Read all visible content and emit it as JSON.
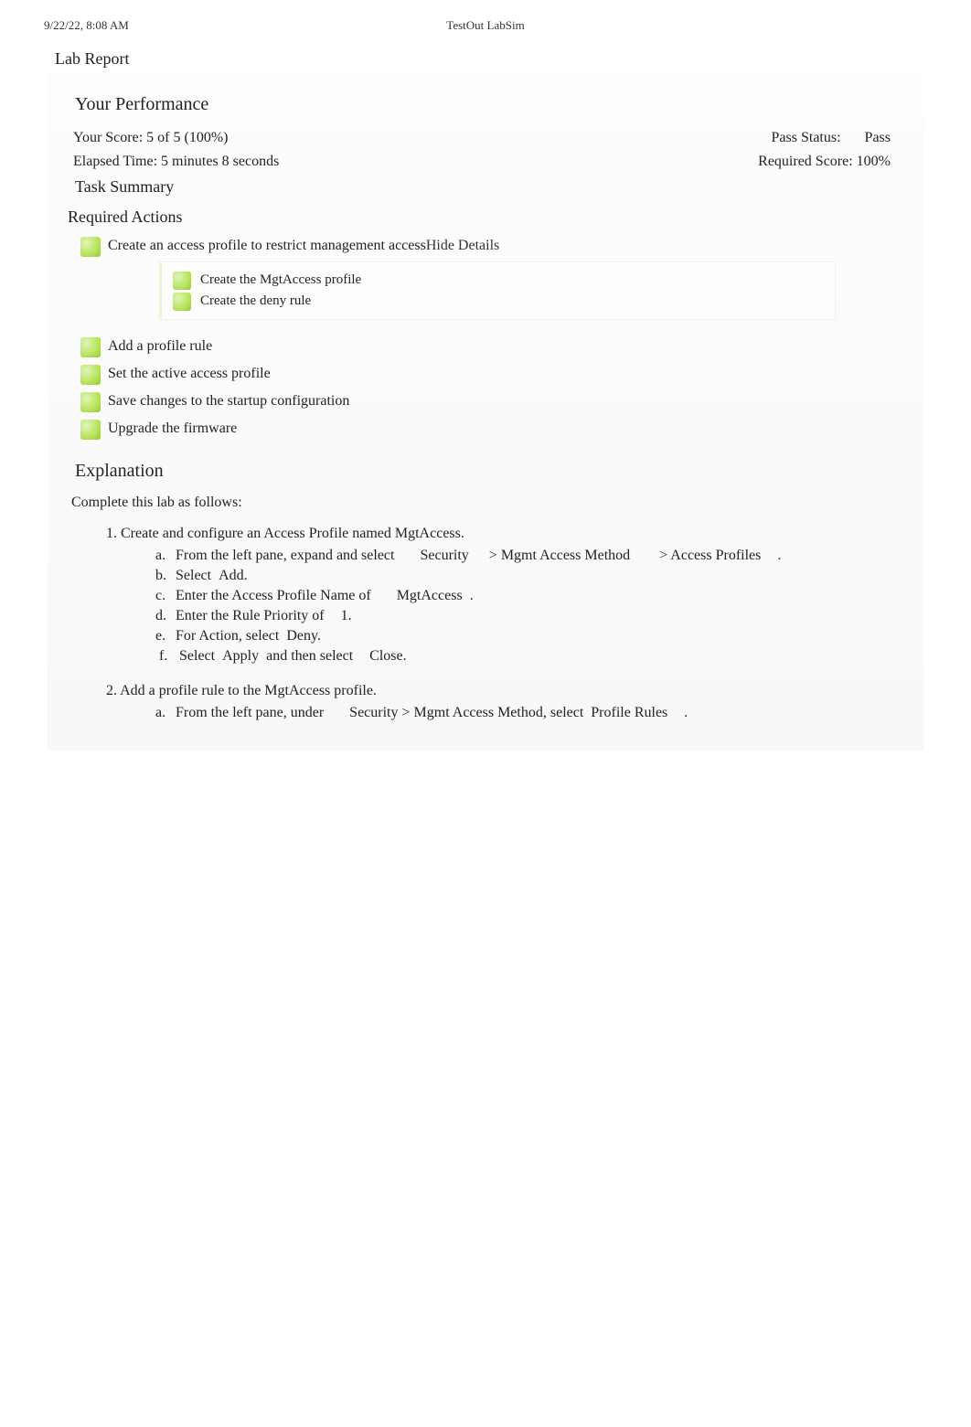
{
  "header": {
    "datetime": "9/22/22, 8:08 AM",
    "center": "TestOut LabSim"
  },
  "lab_title": "Lab Report",
  "performance": {
    "heading": "Your Performance",
    "score_label": "Your Score: 5 of 5 (100%)",
    "pass_status_label": "Pass Status:",
    "pass_status_value": "Pass",
    "elapsed_label": "Elapsed Time: 5 minutes 8 seconds",
    "required_label": "Required Score: 100%"
  },
  "task_summary": {
    "heading": "Task Summary",
    "required_label": "Required Actions",
    "items": [
      {
        "text": "Create an access profile to restrict management access",
        "hide": "Hide Details",
        "sub": [
          "Create the MgtAccess profile",
          "Create the deny rule"
        ]
      },
      {
        "text": "Add a profile rule"
      },
      {
        "text": "Set the active access profile"
      },
      {
        "text": "Save changes to the startup configuration"
      },
      {
        "text": "Upgrade the firmware"
      }
    ]
  },
  "explanation": {
    "heading": "Explanation",
    "intro": "Complete this lab as follows:",
    "steps": [
      {
        "num": "1.",
        "title": "Create and configure an Access Profile named MgtAccess.",
        "subs": [
          {
            "m": "a.",
            "pre": "From the left pane, expand and select",
            "k1": "Security",
            "mid1": " > ",
            "k2": "Mgmt Access Method",
            "mid2": " > ",
            "k3": "Access Profiles",
            "post": "."
          },
          {
            "m": "b.",
            "pre": "Select",
            "k1": "Add",
            "post": "."
          },
          {
            "m": "c.",
            "pre": "Enter the Access Profile Name of",
            "k1": "MgtAccess",
            "post": "."
          },
          {
            "m": "d.",
            "pre": "Enter the Rule Priority of",
            "k1": "1",
            "post": "."
          },
          {
            "m": "e.",
            "pre": "For Action, select",
            "k1": "Deny",
            "post": "."
          },
          {
            "m": "f.",
            "pre": "Select",
            "k1": "Apply",
            "mid1": " and then select",
            "k2": "Close",
            "post": "."
          }
        ]
      },
      {
        "num": "2.",
        "title": "Add a profile rule to the MgtAccess profile.",
        "subs": [
          {
            "m": "a.",
            "pre": "From the left pane, under",
            "k1": "Security",
            "mid1": " > ",
            "k2": "Mgmt Access Method",
            "mid2": ", select",
            "k3": "Profile Rules",
            "post": "."
          }
        ]
      }
    ]
  }
}
